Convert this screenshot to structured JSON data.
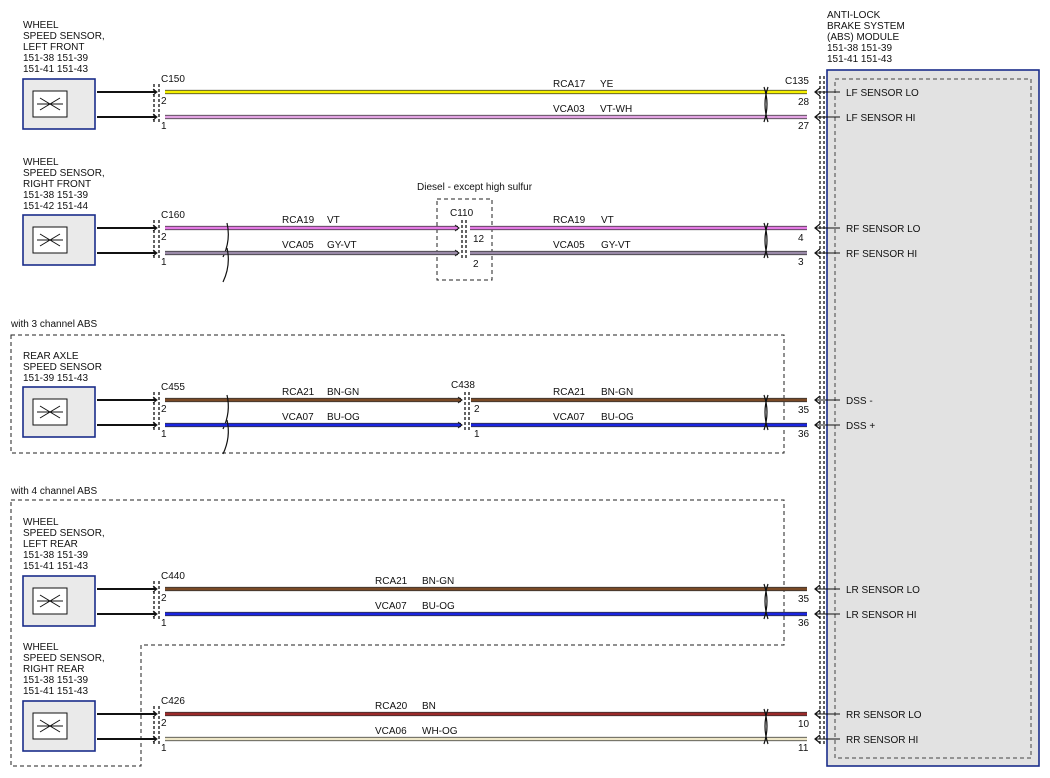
{
  "colors": {
    "YE": "#f5f000",
    "VT-WH": "#e2a4e2",
    "VT": "#e47ae4",
    "GY-VT": "#9a8aa8",
    "BN-GN": "#7a4a26",
    "BU-OG": "#1b25e0",
    "BN": "#9b2a2a",
    "WH-OG": "#eee7c8",
    "module_border": "#1a2d8a",
    "module_fill": "#e2e2e2"
  },
  "module": {
    "title_lines": [
      "ANTI-LOCK",
      "BRAKE SYSTEM",
      "(ABS) MODULE",
      "151-38   151-39",
      "151-41   151-43"
    ],
    "connector": "C135"
  },
  "notes": {
    "diesel": "Diesel - except high sulfur",
    "three_channel": "with 3 channel ABS",
    "four_channel": "with 4 channel ABS"
  },
  "sensors": [
    {
      "lines": [
        "WHEEL",
        "SPEED SENSOR,",
        "LEFT FRONT",
        "151-38   151-39",
        "151-41   151-43"
      ]
    },
    {
      "lines": [
        "WHEEL",
        "SPEED SENSOR,",
        "RIGHT FRONT",
        "151-38   151-39",
        "151-42   151-44"
      ]
    },
    {
      "lines": [
        "REAR AXLE",
        "SPEED SENSOR",
        "151-39   151-43"
      ]
    },
    {
      "lines": [
        "WHEEL",
        "SPEED SENSOR,",
        "LEFT REAR",
        "151-38   151-39",
        "151-41   151-43"
      ]
    },
    {
      "lines": [
        "WHEEL",
        "SPEED SENSOR,",
        "RIGHT REAR",
        "151-38   151-39",
        "151-41   151-43"
      ]
    }
  ],
  "circuits": [
    {
      "connector": "C150",
      "wires": [
        {
          "pin_l": "2",
          "circuit": "RCA17",
          "color": "YE",
          "pin_r": "28",
          "signal": "LF SENSOR LO"
        },
        {
          "pin_l": "1",
          "circuit": "VCA03",
          "color": "VT-WH",
          "pin_r": "27",
          "signal": "LF SENSOR HI"
        }
      ]
    },
    {
      "connector": "C160",
      "mid_connector": "C110",
      "wires": [
        {
          "pin_l": "2",
          "circuit": "RCA19",
          "color": "VT",
          "mid_pin": "12",
          "circuit2": "RCA19",
          "color2": "VT",
          "pin_r": "4",
          "signal": "RF SENSOR LO"
        },
        {
          "pin_l": "1",
          "circuit": "VCA05",
          "color": "GY-VT",
          "mid_pin": "2",
          "circuit2": "VCA05",
          "color2": "GY-VT",
          "pin_r": "3",
          "signal": "RF SENSOR HI"
        }
      ]
    },
    {
      "connector": "C455",
      "mid_connector": "C438",
      "wires": [
        {
          "pin_l": "2",
          "circuit": "RCA21",
          "color": "BN-GN",
          "mid_pin": "2",
          "circuit2": "RCA21",
          "color2": "BN-GN",
          "pin_r": "35",
          "signal": "DSS -"
        },
        {
          "pin_l": "1",
          "circuit": "VCA07",
          "color": "BU-OG",
          "mid_pin": "1",
          "circuit2": "VCA07",
          "color2": "BU-OG",
          "pin_r": "36",
          "signal": "DSS +"
        }
      ]
    },
    {
      "connector": "C440",
      "wires": [
        {
          "pin_l": "2",
          "circuit": "RCA21",
          "color": "BN-GN",
          "pin_r": "35",
          "signal": "LR SENSOR LO"
        },
        {
          "pin_l": "1",
          "circuit": "VCA07",
          "color": "BU-OG",
          "pin_r": "36",
          "signal": "LR SENSOR HI"
        }
      ]
    },
    {
      "connector": "C426",
      "wires": [
        {
          "pin_l": "2",
          "circuit": "RCA20",
          "color": "BN",
          "pin_r": "10",
          "signal": "RR SENSOR LO"
        },
        {
          "pin_l": "1",
          "circuit": "VCA06",
          "color": "WH-OG",
          "pin_r": "11",
          "signal": "RR SENSOR HI"
        }
      ]
    }
  ]
}
